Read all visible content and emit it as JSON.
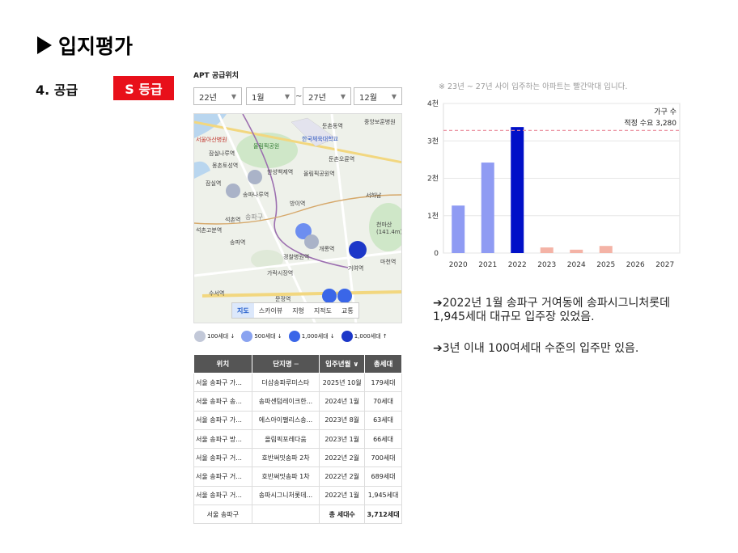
{
  "header": {
    "title": "입지평가",
    "section": "4.  공급",
    "grade": "S 등급"
  },
  "apt": {
    "title": "APT 공급위치",
    "filters": {
      "from_year": "22년",
      "from_month": "1월",
      "tilde": "~",
      "to_year": "27년",
      "to_month": "12월"
    },
    "map_tabs": [
      "지도",
      "스카이뷰",
      "지형",
      "지적도",
      "교통"
    ],
    "map_labels": [
      "서울아산병원",
      "둔촌동역",
      "중앙보훈병원",
      "잠실나루역",
      "올림픽공원",
      "한국체육대학교",
      "둔촌오륜역",
      "몽촌토성역",
      "잠실역",
      "한성백제역",
      "올림픽공원역",
      "송파나루역",
      "방이역",
      "석촌역",
      "서하남",
      "석촌고분역",
      "천마산(141.4m)",
      "송파역",
      "개롱역",
      "거여역",
      "마천역",
      "경찰병원역",
      "가락시장역",
      "수서역",
      "문정역",
      "송파구"
    ],
    "legend": [
      "100세대 ↓",
      "500세대 ↓",
      "1,000세대 ↓",
      "1,000세대 ↑"
    ],
    "table": {
      "headers": [
        "위치",
        "단지명 ─",
        "입주년월 ∨",
        "총세대"
      ],
      "rows": [
        [
          "서울 송파구 가...",
          "더샵송파루미스타",
          "2025년 10월",
          "179세대"
        ],
        [
          "서울 송파구 송...",
          "송파센텀레이크한...",
          "2024년 1월",
          "70세대"
        ],
        [
          "서울 송파구 가...",
          "에스아이팰리스송...",
          "2023년 8월",
          "63세대"
        ],
        [
          "서울 송파구 방...",
          "올림픽포레다움",
          "2023년 1월",
          "66세대"
        ],
        [
          "서울 송파구 거...",
          "호반써밋송파 2차",
          "2022년 2월",
          "700세대"
        ],
        [
          "서울 송파구 거...",
          "호반써밋송파 1차",
          "2022년 2월",
          "689세대"
        ],
        [
          "서울 송파구 거...",
          "송파시그니처롯데...",
          "2022년 1월",
          "1,945세대"
        ]
      ],
      "total": [
        "서울 송파구",
        "",
        "총 세대수",
        "3,712세대"
      ]
    }
  },
  "note": "※ 23년 ~ 27년 사이 입주하는 아파트는 빨간막대 입니다.",
  "bullets": [
    "➔2022년 1월 송파구 거여동에 송파시그니처롯데 1,945세대 대규모 입주장 있었음.",
    "➔3년 이내 100여세대 수준의 입주만 있음."
  ],
  "colors": {
    "grade_bg": "#e8101a",
    "bar_past": "#8f9bf3",
    "bar_2022": "#0010c8",
    "bar_future": "#f4b3a6",
    "demand_line": "#e98a9a"
  },
  "chart_data": {
    "type": "bar",
    "categories": [
      "2020",
      "2021",
      "2022",
      "2023",
      "2024",
      "2025",
      "2026",
      "2027"
    ],
    "values": [
      1270,
      2420,
      3370,
      150,
      90,
      190,
      0,
      0
    ],
    "ylim": [
      0,
      4000
    ],
    "yticks": [
      "0",
      "1천",
      "2천",
      "3천",
      "4천"
    ],
    "legend": "가구 수",
    "demand_label": "적정 수요 3,280",
    "demand_value": 3280,
    "grid": true
  }
}
